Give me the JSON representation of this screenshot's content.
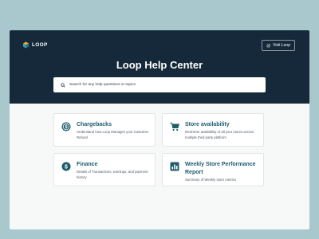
{
  "brand": {
    "name": "LOOP"
  },
  "header": {
    "visit_button_label": "Visit Loop"
  },
  "hero": {
    "title": "Loop Help Center"
  },
  "search": {
    "placeholder": "Search for any help questions or topics"
  },
  "cards": [
    {
      "title": "Chargebacks",
      "description": "Understand how Loop Manages your Customer Refund",
      "icon": "dollar-circle-icon"
    },
    {
      "title": "Store availability",
      "description": "Real-time availability of all your stores across multiple third party platform",
      "icon": "cart-icon"
    },
    {
      "title": "Finance",
      "description": "Details of Transactions, earnings, and payment history",
      "icon": "dollar-circle-icon"
    },
    {
      "title": "Weekly Store Performance Report",
      "description": "Summary of Weekly store metrics",
      "icon": "bar-chart-icon"
    }
  ],
  "colors": {
    "background": "#a9c8ce",
    "hero": "#15293a",
    "accent": "#1d5c6b",
    "card_border": "#e2e6e8"
  }
}
